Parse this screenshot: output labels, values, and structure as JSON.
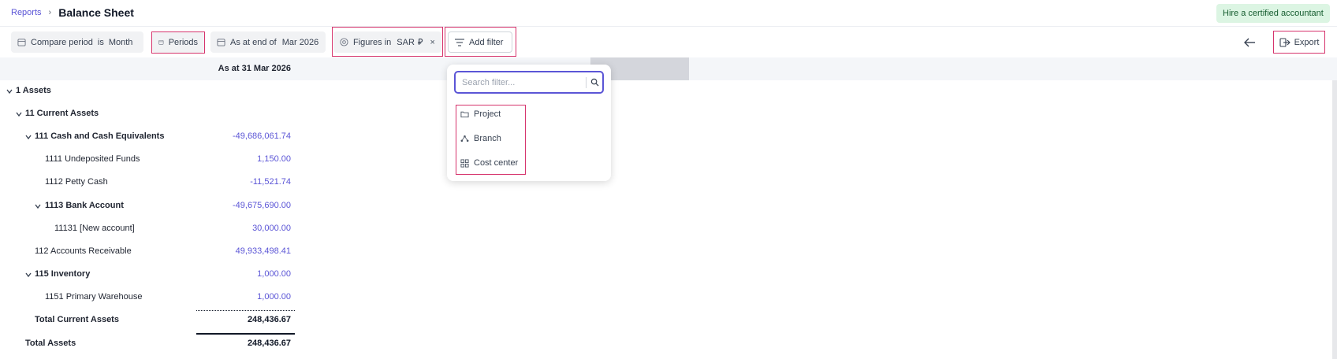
{
  "breadcrumb": {
    "parent": "Reports",
    "separator": "›",
    "title": "Balance Sheet"
  },
  "header": {
    "hire_label": "Hire a certified accountant"
  },
  "filters": {
    "compare": {
      "label": "Compare period",
      "op": "is",
      "value": "Month"
    },
    "periods": {
      "label": "Periods"
    },
    "as_at": {
      "label": "As at end of",
      "value": "Mar 2026"
    },
    "figures": {
      "label": "Figures in",
      "value": "SAR",
      "currency_symbol": "⃁",
      "remove": "×"
    },
    "add_filter": {
      "label": "Add filter"
    }
  },
  "toolbar": {
    "back_icon": "arrow-left-icon",
    "export_label": "Export"
  },
  "column": {
    "header": "As at 31 Mar 2026"
  },
  "rows": [
    {
      "label": "1 Assets",
      "value": "",
      "bold": true,
      "chevron": true
    },
    {
      "label": "11 Current Assets",
      "value": "",
      "bold": true,
      "chevron": true
    },
    {
      "label": "111 Cash and Cash Equivalents",
      "value": "-49,686,061.74",
      "bold": true,
      "chevron": true
    },
    {
      "label": "1111 Undeposited Funds",
      "value": "1,150.00",
      "bold": false,
      "chevron": false
    },
    {
      "label": "1112 Petty Cash",
      "value": "-11,521.74",
      "bold": false,
      "chevron": false
    },
    {
      "label": "1113 Bank Account",
      "value": "-49,675,690.00",
      "bold": true,
      "chevron": true
    },
    {
      "label": "11131 [New account]",
      "value": "30,000.00",
      "bold": false,
      "chevron": false
    },
    {
      "label": "112 Accounts Receivable",
      "value": "49,933,498.41",
      "bold": false,
      "chevron": false
    },
    {
      "label": "115 Inventory",
      "value": "1,000.00",
      "bold": true,
      "chevron": true
    },
    {
      "label": "1151 Primary Warehouse",
      "value": "1,000.00",
      "bold": false,
      "chevron": false
    },
    {
      "label": "Total Current Assets",
      "value": "248,436.67",
      "bold": true,
      "chevron": false,
      "total": true
    },
    {
      "label": "Total Assets",
      "value": "248,436.67",
      "bold": true,
      "chevron": false,
      "total": true
    }
  ],
  "filter_dropdown": {
    "search_placeholder": "Search filter...",
    "options": [
      {
        "label": "Project",
        "icon": "folder-icon"
      },
      {
        "label": "Branch",
        "icon": "hierarchy-icon"
      },
      {
        "label": "Cost center",
        "icon": "grid-icon"
      }
    ]
  },
  "colors": {
    "accent": "#5b55d6",
    "highlight": "#d6336c",
    "hire_bg": "#dcf5e3",
    "hire_text": "#155c2f"
  }
}
